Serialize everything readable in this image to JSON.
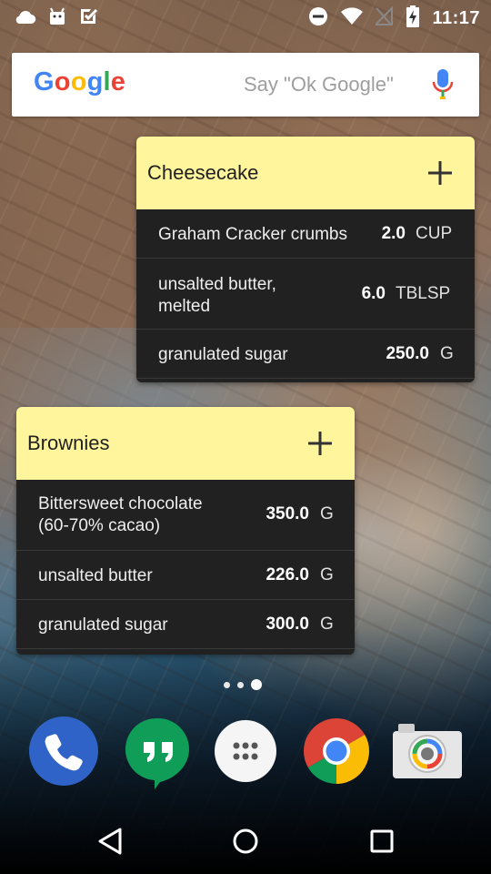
{
  "status_bar": {
    "time": "11:17"
  },
  "search": {
    "logo": [
      "G",
      "o",
      "o",
      "g",
      "l",
      "e"
    ],
    "logo_colors": [
      "#4285F4",
      "#EA4335",
      "#FBBC05",
      "#4285F4",
      "#34A853",
      "#EA4335"
    ],
    "hint": "Say \"Ok Google\""
  },
  "widget_cheesecake": {
    "title": "Cheesecake",
    "rows": [
      {
        "name": "Graham Cracker crumbs",
        "qty": "2.0",
        "unit": "CUP"
      },
      {
        "name_line1": "unsalted butter,",
        "name_line2": "melted",
        "qty": "6.0",
        "unit": "TBLSP"
      },
      {
        "name": "granulated sugar",
        "qty": "250.0",
        "unit": "G"
      }
    ]
  },
  "widget_brownies": {
    "title": "Brownies",
    "rows": [
      {
        "name_line1": "Bittersweet chocolate",
        "name_line2": "(60-70% cacao)",
        "qty": "350.0",
        "unit": "G"
      },
      {
        "name": "unsalted butter",
        "qty": "226.0",
        "unit": "G"
      },
      {
        "name": "granulated sugar",
        "qty": "300.0",
        "unit": "G"
      }
    ]
  },
  "colors": {
    "widget_header": "#fff59d",
    "widget_body": "#212121"
  },
  "dock": [
    "phone-icon",
    "hangouts-icon",
    "app-drawer-icon",
    "chrome-icon",
    "camera-icon"
  ],
  "nav": [
    "back-icon",
    "home-icon",
    "recents-icon"
  ]
}
